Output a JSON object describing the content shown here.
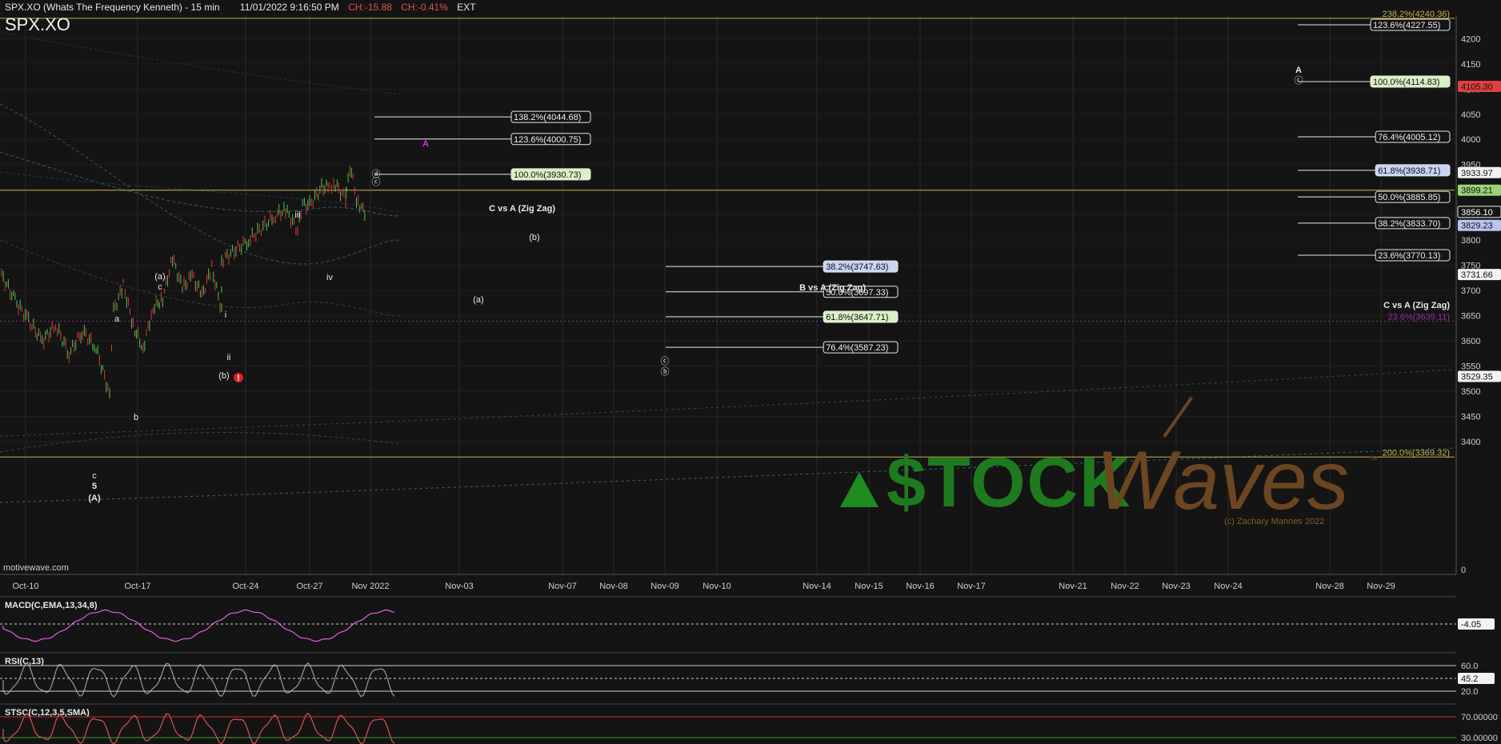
{
  "header": {
    "title": "SPX.XO (Whats The Frequency Kenneth) - 15 min",
    "datetime": "11/01/2022 9:16:50 PM",
    "change": "CH:-15.88",
    "change_pct": "CH:-0.41%",
    "session": "EXT",
    "symbol": "SPX.XO"
  },
  "watermark": {
    "source": "motivewave.com",
    "brand_left": "$TOCK",
    "brand_right": "Waves",
    "tm": "™",
    "copyright": "(c) Zachary Mannes 2022"
  },
  "colors": {
    "background": "#141414",
    "grid": "#2a2a2a",
    "up": "#4fc24f",
    "down": "#d33a3a",
    "yellow_line": "#c8b24a",
    "purple": "#9a2e9a",
    "magenta_label": "#e02be0",
    "fib_green_bg": "#d9f2c4",
    "fib_blue_bg": "#c9d3f2",
    "fib_white_bg": "#f2f2f2"
  },
  "chart_data": {
    "type": "line",
    "title": "SPX.XO (Whats The Frequency Kenneth) - 15 min",
    "y_axis": {
      "ticks": [
        3400,
        3450,
        3500,
        3550,
        3600,
        3650,
        3700,
        3750,
        3800,
        3850,
        3900,
        3950,
        4000,
        4050,
        4100,
        4150,
        4200
      ],
      "range": [
        3365,
        4245
      ]
    },
    "x_axis": {
      "tick_labels": [
        "Oct-10",
        "Oct-17",
        "Oct-24",
        "Oct-27",
        "Nov 2022",
        "Nov-03",
        "Nov-07",
        "Nov-08",
        "Nov-09",
        "Nov-10",
        "Nov-14",
        "Nov-15",
        "Nov-16",
        "Nov-17",
        "Nov-21",
        "Nov-22",
        "Nov-23",
        "Nov-24",
        "Nov-28",
        "Nov-29"
      ]
    },
    "price_path": [
      [
        "Oct-10",
        3730
      ],
      [
        "Oct-10",
        3680
      ],
      [
        "Oct-10",
        3640
      ],
      [
        "Oct-10",
        3600
      ],
      [
        "Oct-10",
        3630
      ],
      [
        "Oct-10",
        3575
      ],
      [
        "Oct-10",
        3620
      ],
      [
        "Oct-10",
        3585
      ],
      [
        "Oct-10",
        3495
      ],
      [
        "Oct-17",
        3660
      ],
      [
        "Oct-17",
        3710
      ],
      [
        "Oct-17",
        3630
      ],
      [
        "Oct-17",
        3585
      ],
      [
        "Oct-17",
        3665
      ],
      [
        "Oct-17",
        3685
      ],
      [
        "Oct-17",
        3765
      ],
      [
        "Oct-17",
        3705
      ],
      [
        "Oct-17",
        3730
      ],
      [
        "Oct-17",
        3690
      ],
      [
        "Oct-17",
        3745
      ],
      [
        "Oct-17",
        3660
      ],
      [
        "Oct-24",
        3760
      ],
      [
        "Oct-24",
        3800
      ],
      [
        "Oct-24",
        3850
      ],
      [
        "Oct-24",
        3870
      ],
      [
        "Oct-24",
        3905
      ],
      [
        "Oct-27",
        3860
      ],
      [
        "Oct-27",
        3820
      ],
      [
        "Oct-27",
        3870
      ],
      [
        "Oct-27",
        3905
      ],
      [
        "Oct-27",
        3915
      ],
      [
        "Oct-27",
        3882
      ],
      [
        "Nov 2022",
        3910
      ],
      [
        "Nov 2022",
        3940
      ],
      [
        "Nov 2022",
        3875
      ],
      [
        "Nov 2022",
        3862
      ],
      [
        "Nov 2022",
        3856
      ]
    ],
    "current_prices": {
      "last": "3856.10",
      "markers": [
        "4105.30",
        "3933.97",
        "3899.21",
        "3829.23",
        "3731.66",
        "3529.35"
      ]
    },
    "horizontal_levels": [
      {
        "label": "238.2%(4240.36)",
        "value": 4240.36,
        "color": "#c8b24a"
      },
      {
        "label": "200.0%(3369.32)",
        "value": 3369.32,
        "color": "#c8b24a"
      },
      {
        "label": "23.6%(3639.11)",
        "value": 3639.11,
        "color": "#9a2e9a"
      },
      {
        "label": "",
        "value": 3899.21,
        "color": "#c8b24a"
      }
    ],
    "fib_sets": [
      {
        "name": "C vs A (Zig Zag)",
        "levels": [
          {
            "label": "138.2%(4044.68)",
            "value": 4044.68,
            "style": "plain"
          },
          {
            "label": "123.6%(4000.75)",
            "value": 4000.75,
            "style": "plain"
          },
          {
            "label": "100.0%(3930.73)",
            "value": 3930.73,
            "style": "green"
          }
        ]
      },
      {
        "name": "B vs A (Zig Zag)",
        "levels": [
          {
            "label": "38.2%(3747.63)",
            "value": 3747.63,
            "style": "blue"
          },
          {
            "label": "50.0%(3697.33)",
            "value": 3697.33,
            "style": "plain"
          },
          {
            "label": "61.8%(3647.71)",
            "value": 3647.71,
            "style": "green"
          },
          {
            "label": "76.4%(3587.23)",
            "value": 3587.23,
            "style": "plain"
          }
        ]
      },
      {
        "name": "C vs A (Zig Zag)",
        "levels": [
          {
            "label": "123.6%(4227.55)",
            "value": 4227.55,
            "style": "plain"
          },
          {
            "label": "100.0%(4114.83)",
            "value": 4114.83,
            "style": "green"
          },
          {
            "label": "76.4%(4005.12)",
            "value": 4005.12,
            "style": "plain"
          },
          {
            "label": "61.8%(3938.71)",
            "value": 3938.71,
            "style": "blue"
          },
          {
            "label": "50.0%(3885.85)",
            "value": 3885.85,
            "style": "plain"
          },
          {
            "label": "38.2%(3833.70)",
            "value": 3833.7,
            "style": "plain"
          },
          {
            "label": "23.6%(3770.13)",
            "value": 3770.13,
            "style": "plain"
          }
        ]
      }
    ],
    "wave_labels": [
      "(A)",
      "5",
      "c",
      "a",
      "b",
      "(a)",
      "c",
      "(b)",
      "ii",
      "iii",
      "iv",
      "i",
      "ⓒ",
      "ⓓ",
      "A",
      "(b)",
      "(a)",
      "ⓒ",
      "ⓑ",
      "A",
      "ⓒ"
    ],
    "indicators": [
      {
        "name": "MACD(C,EMA,13,34,8)",
        "value": "-4.05"
      },
      {
        "name": "RSI(C,13)",
        "levels": [
          "60.0",
          "20.0"
        ],
        "value": "45.2"
      },
      {
        "name": "STSC(C,12,3,5,SMA)",
        "levels": [
          "70.00000",
          "30.00000"
        ]
      }
    ],
    "axis_zero": "0"
  }
}
